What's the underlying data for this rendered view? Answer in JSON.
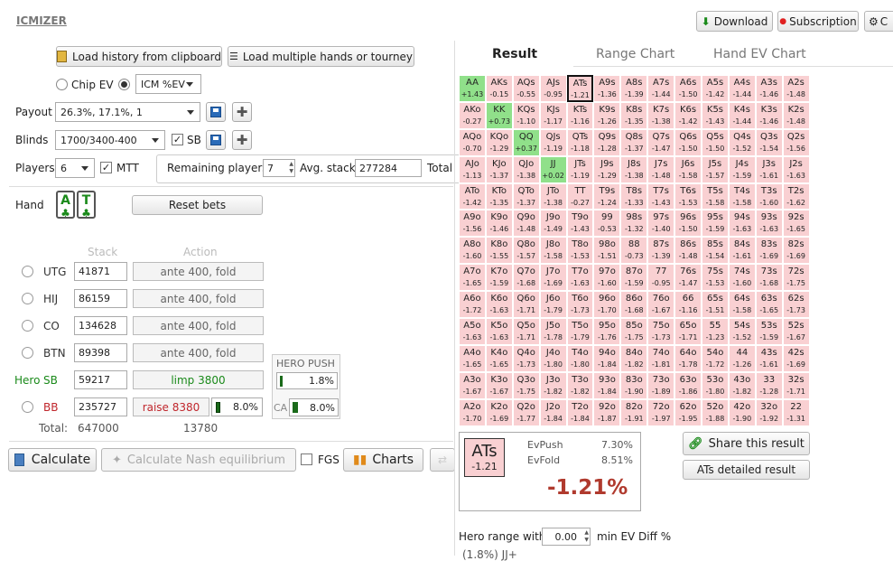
{
  "app": {
    "logo": "ICMIZER"
  },
  "toolbar": {
    "download": "Download",
    "subscription": "Subscription",
    "settings": "C"
  },
  "buttons": {
    "load_clipboard": "Load history from clipboard",
    "load_multiple": "Load multiple hands or tourney",
    "reset_bets": "Reset bets",
    "calculate": "Calculate",
    "nash": "Calculate Nash equilibrium",
    "fgs": "FGS",
    "charts": "Charts",
    "share": "Share this result",
    "detailed": "ATs detailed result"
  },
  "ev_mode": {
    "chip_ev": "Chip EV",
    "icm": "ICM %EV",
    "selected": "icm"
  },
  "payout": {
    "label": "Payout",
    "value": "26.3%, 17.1%, 1"
  },
  "blinds": {
    "label": "Blinds",
    "value": "1700/3400-400",
    "sb_label": "SB",
    "sb_checked": true
  },
  "players": {
    "label": "Players",
    "value": "6",
    "mtt_label": "MTT",
    "mtt_checked": true,
    "remaining_label": "Remaining players",
    "remaining_value": "7",
    "avg_label": "Avg. stack",
    "avg_value": "277284",
    "total_label": "Total"
  },
  "hand": {
    "label": "Hand",
    "cards": [
      "A",
      "T"
    ]
  },
  "table_headers": {
    "stack": "Stack",
    "action": "Action"
  },
  "positions": [
    {
      "name": "UTG",
      "stack": "41871",
      "action": "ante 400, fold",
      "color": "#666"
    },
    {
      "name": "HIJ",
      "stack": "86159",
      "action": "ante 400, fold",
      "color": "#666"
    },
    {
      "name": "CO",
      "stack": "134628",
      "action": "ante 400, fold",
      "color": "#666"
    },
    {
      "name": "BTN",
      "stack": "89398",
      "action": "ante 400, fold",
      "color": "#666"
    },
    {
      "name": "SB",
      "prefix": "Hero",
      "stack": "59217",
      "action": "limp 3800",
      "color": "#1a8a1a"
    },
    {
      "name": "BB",
      "stack": "235727",
      "action": "raise 8380",
      "color": "#c0262c",
      "range": "8.0%"
    }
  ],
  "hero_push": {
    "title": "HERO PUSH",
    "value": "1.8%",
    "ca_label": "CA",
    "ca_value": "8.0%"
  },
  "totals": {
    "label": "Total:",
    "stack": "647000",
    "action": "13780"
  },
  "tabs": {
    "result": "Result",
    "range_chart": "Range Chart",
    "hand_ev_chart": "Hand EV Chart",
    "active": "result"
  },
  "matrix": [
    [
      [
        "AA",
        "+1.43"
      ],
      [
        "AKs",
        "-0.15"
      ],
      [
        "AQs",
        "-0.55"
      ],
      [
        "AJs",
        "-0.95"
      ],
      [
        "ATs",
        "-1.21"
      ],
      [
        "A9s",
        "-1.36"
      ],
      [
        "A8s",
        "-1.39"
      ],
      [
        "A7s",
        "-1.44"
      ],
      [
        "A6s",
        "-1.50"
      ],
      [
        "A5s",
        "-1.42"
      ],
      [
        "A4s",
        "-1.44"
      ],
      [
        "A3s",
        "-1.46"
      ],
      [
        "A2s",
        "-1.48"
      ]
    ],
    [
      [
        "AKo",
        "-0.27"
      ],
      [
        "KK",
        "+0.73"
      ],
      [
        "KQs",
        "-1.10"
      ],
      [
        "KJs",
        "-1.17"
      ],
      [
        "KTs",
        "-1.16"
      ],
      [
        "K9s",
        "-1.26"
      ],
      [
        "K8s",
        "-1.35"
      ],
      [
        "K7s",
        "-1.38"
      ],
      [
        "K6s",
        "-1.42"
      ],
      [
        "K5s",
        "-1.43"
      ],
      [
        "K4s",
        "-1.44"
      ],
      [
        "K3s",
        "-1.46"
      ],
      [
        "K2s",
        "-1.48"
      ]
    ],
    [
      [
        "AQo",
        "-0.70"
      ],
      [
        "KQo",
        "-1.29"
      ],
      [
        "QQ",
        "+0.37"
      ],
      [
        "QJs",
        "-1.19"
      ],
      [
        "QTs",
        "-1.18"
      ],
      [
        "Q9s",
        "-1.28"
      ],
      [
        "Q8s",
        "-1.37"
      ],
      [
        "Q7s",
        "-1.47"
      ],
      [
        "Q6s",
        "-1.50"
      ],
      [
        "Q5s",
        "-1.50"
      ],
      [
        "Q4s",
        "-1.52"
      ],
      [
        "Q3s",
        "-1.54"
      ],
      [
        "Q2s",
        "-1.56"
      ]
    ],
    [
      [
        "AJo",
        "-1.13"
      ],
      [
        "KJo",
        "-1.37"
      ],
      [
        "QJo",
        "-1.38"
      ],
      [
        "JJ",
        "+0.02"
      ],
      [
        "JTs",
        "-1.19"
      ],
      [
        "J9s",
        "-1.29"
      ],
      [
        "J8s",
        "-1.38"
      ],
      [
        "J7s",
        "-1.48"
      ],
      [
        "J6s",
        "-1.58"
      ],
      [
        "J5s",
        "-1.57"
      ],
      [
        "J4s",
        "-1.59"
      ],
      [
        "J3s",
        "-1.61"
      ],
      [
        "J2s",
        "-1.63"
      ]
    ],
    [
      [
        "ATo",
        "-1.42"
      ],
      [
        "KTo",
        "-1.35"
      ],
      [
        "QTo",
        "-1.37"
      ],
      [
        "JTo",
        "-1.38"
      ],
      [
        "TT",
        "-0.27"
      ],
      [
        "T9s",
        "-1.24"
      ],
      [
        "T8s",
        "-1.33"
      ],
      [
        "T7s",
        "-1.43"
      ],
      [
        "T6s",
        "-1.53"
      ],
      [
        "T5s",
        "-1.58"
      ],
      [
        "T4s",
        "-1.58"
      ],
      [
        "T3s",
        "-1.60"
      ],
      [
        "T2s",
        "-1.62"
      ]
    ],
    [
      [
        "A9o",
        "-1.56"
      ],
      [
        "K9o",
        "-1.46"
      ],
      [
        "Q9o",
        "-1.48"
      ],
      [
        "J9o",
        "-1.49"
      ],
      [
        "T9o",
        "-1.43"
      ],
      [
        "99",
        "-0.53"
      ],
      [
        "98s",
        "-1.32"
      ],
      [
        "97s",
        "-1.40"
      ],
      [
        "96s",
        "-1.50"
      ],
      [
        "95s",
        "-1.59"
      ],
      [
        "94s",
        "-1.63"
      ],
      [
        "93s",
        "-1.63"
      ],
      [
        "92s",
        "-1.65"
      ]
    ],
    [
      [
        "A8o",
        "-1.60"
      ],
      [
        "K8o",
        "-1.55"
      ],
      [
        "Q8o",
        "-1.57"
      ],
      [
        "J8o",
        "-1.58"
      ],
      [
        "T8o",
        "-1.53"
      ],
      [
        "98o",
        "-1.51"
      ],
      [
        "88",
        "-0.73"
      ],
      [
        "87s",
        "-1.39"
      ],
      [
        "86s",
        "-1.48"
      ],
      [
        "85s",
        "-1.54"
      ],
      [
        "84s",
        "-1.61"
      ],
      [
        "83s",
        "-1.69"
      ],
      [
        "82s",
        "-1.69"
      ]
    ],
    [
      [
        "A7o",
        "-1.65"
      ],
      [
        "K7o",
        "-1.59"
      ],
      [
        "Q7o",
        "-1.68"
      ],
      [
        "J7o",
        "-1.69"
      ],
      [
        "T7o",
        "-1.63"
      ],
      [
        "97o",
        "-1.60"
      ],
      [
        "87o",
        "-1.59"
      ],
      [
        "77",
        "-0.95"
      ],
      [
        "76s",
        "-1.47"
      ],
      [
        "75s",
        "-1.53"
      ],
      [
        "74s",
        "-1.60"
      ],
      [
        "73s",
        "-1.68"
      ],
      [
        "72s",
        "-1.75"
      ]
    ],
    [
      [
        "A6o",
        "-1.72"
      ],
      [
        "K6o",
        "-1.63"
      ],
      [
        "Q6o",
        "-1.71"
      ],
      [
        "J6o",
        "-1.79"
      ],
      [
        "T6o",
        "-1.73"
      ],
      [
        "96o",
        "-1.70"
      ],
      [
        "86o",
        "-1.68"
      ],
      [
        "76o",
        "-1.67"
      ],
      [
        "66",
        "-1.16"
      ],
      [
        "65s",
        "-1.51"
      ],
      [
        "64s",
        "-1.58"
      ],
      [
        "63s",
        "-1.65"
      ],
      [
        "62s",
        "-1.73"
      ]
    ],
    [
      [
        "A5o",
        "-1.63"
      ],
      [
        "K5o",
        "-1.63"
      ],
      [
        "Q5o",
        "-1.71"
      ],
      [
        "J5o",
        "-1.78"
      ],
      [
        "T5o",
        "-1.79"
      ],
      [
        "95o",
        "-1.76"
      ],
      [
        "85o",
        "-1.75"
      ],
      [
        "75o",
        "-1.73"
      ],
      [
        "65o",
        "-1.71"
      ],
      [
        "55",
        "-1.23"
      ],
      [
        "54s",
        "-1.52"
      ],
      [
        "53s",
        "-1.59"
      ],
      [
        "52s",
        "-1.67"
      ]
    ],
    [
      [
        "A4o",
        "-1.65"
      ],
      [
        "K4o",
        "-1.65"
      ],
      [
        "Q4o",
        "-1.73"
      ],
      [
        "J4o",
        "-1.80"
      ],
      [
        "T4o",
        "-1.80"
      ],
      [
        "94o",
        "-1.84"
      ],
      [
        "84o",
        "-1.82"
      ],
      [
        "74o",
        "-1.81"
      ],
      [
        "64o",
        "-1.78"
      ],
      [
        "54o",
        "-1.72"
      ],
      [
        "44",
        "-1.26"
      ],
      [
        "43s",
        "-1.61"
      ],
      [
        "42s",
        "-1.69"
      ]
    ],
    [
      [
        "A3o",
        "-1.67"
      ],
      [
        "K3o",
        "-1.67"
      ],
      [
        "Q3o",
        "-1.75"
      ],
      [
        "J3o",
        "-1.82"
      ],
      [
        "T3o",
        "-1.82"
      ],
      [
        "93o",
        "-1.84"
      ],
      [
        "83o",
        "-1.90"
      ],
      [
        "73o",
        "-1.89"
      ],
      [
        "63o",
        "-1.86"
      ],
      [
        "53o",
        "-1.80"
      ],
      [
        "43o",
        "-1.82"
      ],
      [
        "33",
        "-1.28"
      ],
      [
        "32s",
        "-1.71"
      ]
    ],
    [
      [
        "A2o",
        "-1.70"
      ],
      [
        "K2o",
        "-1.69"
      ],
      [
        "Q2o",
        "-1.77"
      ],
      [
        "J2o",
        "-1.84"
      ],
      [
        "T2o",
        "-1.84"
      ],
      [
        "92o",
        "-1.87"
      ],
      [
        "82o",
        "-1.91"
      ],
      [
        "72o",
        "-1.97"
      ],
      [
        "62o",
        "-1.95"
      ],
      [
        "52o",
        "-1.88"
      ],
      [
        "42o",
        "-1.90"
      ],
      [
        "32o",
        "-1.92"
      ],
      [
        "22",
        "-1.31"
      ]
    ]
  ],
  "result": {
    "hand": "ATs",
    "hand_ev": "-1.21",
    "evpush_label": "EvPush",
    "evpush_value": "7.30%",
    "evfold_label": "EvFold",
    "evfold_value": "8.51%",
    "diff": "-1.21%"
  },
  "hero_range": {
    "label": "Hero range with",
    "value": "0.00",
    "suffix": "min EV Diff %",
    "range_text": "(1.8%) JJ+"
  },
  "colors": {
    "positive": "#90e08a",
    "negative": "#f9d0d2",
    "diff": "#b03a2e",
    "hero": "#1a8a1a",
    "bb": "#c0262c"
  }
}
